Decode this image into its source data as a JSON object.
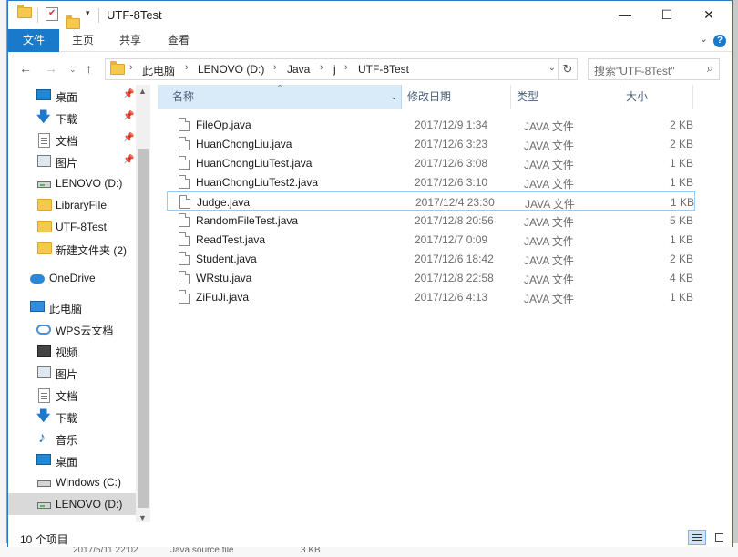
{
  "window": {
    "title": "UTF-8Test",
    "controls": {
      "minimize": "—",
      "maximize": "☐",
      "close": "✕"
    }
  },
  "ribbon": {
    "tabs": [
      "文件",
      "主页",
      "共享",
      "查看"
    ],
    "expand_icon": "chevron-down-icon",
    "help": "?"
  },
  "address": {
    "segments": [
      "此电脑",
      "LENOVO (D:)",
      "Java",
      "j",
      "UTF-8Test"
    ],
    "search_placeholder": "搜索\"UTF-8Test\""
  },
  "nav": {
    "quick_access": [
      {
        "label": "桌面",
        "icon": "desktop-icon",
        "pinned": true
      },
      {
        "label": "下载",
        "icon": "download-icon",
        "pinned": true
      },
      {
        "label": "文档",
        "icon": "document-icon",
        "pinned": true
      },
      {
        "label": "图片",
        "icon": "pictures-icon",
        "pinned": true
      },
      {
        "label": "LENOVO (D:)",
        "icon": "drive-icon",
        "pinned": false
      },
      {
        "label": "LibraryFile",
        "icon": "folder-icon",
        "pinned": false
      },
      {
        "label": "UTF-8Test",
        "icon": "folder-icon",
        "pinned": false
      },
      {
        "label": "新建文件夹 (2)",
        "icon": "folder-icon",
        "pinned": false
      }
    ],
    "onedrive": "OneDrive",
    "this_pc": "此电脑",
    "pc_items": [
      {
        "label": "WPS云文档",
        "icon": "wps-cloud-icon"
      },
      {
        "label": "视频",
        "icon": "video-icon"
      },
      {
        "label": "图片",
        "icon": "pictures-icon"
      },
      {
        "label": "文档",
        "icon": "document-icon"
      },
      {
        "label": "下载",
        "icon": "download-icon"
      },
      {
        "label": "音乐",
        "icon": "music-icon"
      },
      {
        "label": "桌面",
        "icon": "desktop-icon"
      },
      {
        "label": "Windows (C:)",
        "icon": "windows-drive-icon"
      },
      {
        "label": "LENOVO (D:)",
        "icon": "drive-icon",
        "selected": true
      }
    ]
  },
  "columns": {
    "name": "名称",
    "date": "修改日期",
    "type": "类型",
    "size": "大小"
  },
  "files": [
    {
      "name": "FileOp.java",
      "date": "2017/12/9 1:34",
      "type": "JAVA 文件",
      "size": "2 KB"
    },
    {
      "name": "HuanChongLiu.java",
      "date": "2017/12/6 3:23",
      "type": "JAVA 文件",
      "size": "2 KB"
    },
    {
      "name": "HuanChongLiuTest.java",
      "date": "2017/12/6 3:08",
      "type": "JAVA 文件",
      "size": "1 KB"
    },
    {
      "name": "HuanChongLiuTest2.java",
      "date": "2017/12/6 3:10",
      "type": "JAVA 文件",
      "size": "1 KB"
    },
    {
      "name": "Judge.java",
      "date": "2017/12/4 23:30",
      "type": "JAVA 文件",
      "size": "1 KB",
      "focused": true
    },
    {
      "name": "RandomFileTest.java",
      "date": "2017/12/8 20:56",
      "type": "JAVA 文件",
      "size": "5 KB"
    },
    {
      "name": "ReadTest.java",
      "date": "2017/12/7 0:09",
      "type": "JAVA 文件",
      "size": "1 KB"
    },
    {
      "name": "Student.java",
      "date": "2017/12/6 18:42",
      "type": "JAVA 文件",
      "size": "2 KB"
    },
    {
      "name": "WRstu.java",
      "date": "2017/12/8 22:58",
      "type": "JAVA 文件",
      "size": "4 KB"
    },
    {
      "name": "ZiFuJi.java",
      "date": "2017/12/6 4:13",
      "type": "JAVA 文件",
      "size": "1 KB"
    }
  ],
  "status": {
    "count": "10 个项目"
  },
  "background": {
    "bottom_date": "2017/5/11 22:02",
    "bottom_type": "Java source file",
    "bottom_size": "3 KB"
  },
  "colors": {
    "accent": "#1979ca",
    "selection": "#d9ebf9",
    "border": "#2b78c5"
  }
}
